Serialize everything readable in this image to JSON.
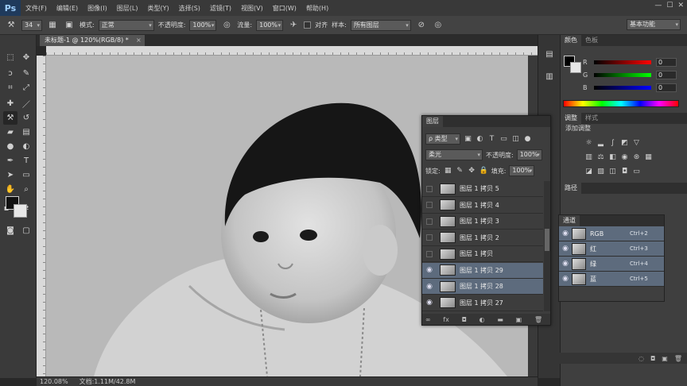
{
  "app": {
    "logo": "Ps"
  },
  "menu": [
    "文件(F)",
    "编辑(E)",
    "图像(I)",
    "图层(L)",
    "类型(Y)",
    "选择(S)",
    "滤镜(T)",
    "视图(V)",
    "窗口(W)",
    "帮助(H)"
  ],
  "window_controls": {
    "min": "—",
    "max": "☐",
    "close": "✕"
  },
  "options": {
    "brush_size": "34",
    "mode_label": "模式:",
    "mode_value": "正常",
    "opacity_label": "不透明度:",
    "opacity_value": "100%",
    "flow_label": "流量:",
    "flow_value": "100%",
    "aligned_label": "对齐",
    "sample_label": "样本:",
    "sample_value": "所有图层",
    "workspace": "基本功能"
  },
  "document": {
    "tab_title": "未标题-1 @ 120%(RGB/8) *",
    "close": "×"
  },
  "status": {
    "zoom": "120.08%",
    "doc_info": "文档:1.11M/42.8M"
  },
  "color_panel": {
    "tabs": [
      "颜色",
      "色板"
    ],
    "channels": [
      {
        "label": "R",
        "value": "0"
      },
      {
        "label": "G",
        "value": "0"
      },
      {
        "label": "B",
        "value": "0"
      }
    ]
  },
  "adjustments_panel": {
    "tabs": [
      "调整",
      "样式"
    ],
    "title": "添加调整"
  },
  "paths_panel": {
    "tab": "路径"
  },
  "channels_panel": {
    "tab": "通道",
    "rows": [
      {
        "name": "RGB",
        "shortcut": "Ctrl+2"
      },
      {
        "name": "红",
        "shortcut": "Ctrl+3"
      },
      {
        "name": "绿",
        "shortcut": "Ctrl+4"
      },
      {
        "name": "蓝",
        "shortcut": "Ctrl+5"
      }
    ]
  },
  "layers_panel": {
    "tab": "图层",
    "filter_value": "ρ 类型",
    "blend_mode": "柔光",
    "opacity_label": "不透明度:",
    "opacity_value": "100%",
    "lock_label": "锁定:",
    "fill_label": "填充:",
    "fill_value": "100%",
    "layers": [
      {
        "name": "图层 1 拷贝 5",
        "visible": false,
        "selected": false
      },
      {
        "name": "图层 1 拷贝 4",
        "visible": false,
        "selected": false
      },
      {
        "name": "图层 1 拷贝 3",
        "visible": false,
        "selected": false
      },
      {
        "name": "图层 1 拷贝 2",
        "visible": false,
        "selected": false
      },
      {
        "name": "图层 1 拷贝",
        "visible": false,
        "selected": false
      },
      {
        "name": "图层 1 拷贝 29",
        "visible": true,
        "selected": true
      },
      {
        "name": "图层 1 拷贝 28",
        "visible": true,
        "selected": true
      },
      {
        "name": "图层 1 拷贝 27",
        "visible": true,
        "selected": false
      }
    ]
  },
  "colors": {
    "menubar": "#393939",
    "panel": "#3f3f3f",
    "selection": "#5d6b7d"
  }
}
